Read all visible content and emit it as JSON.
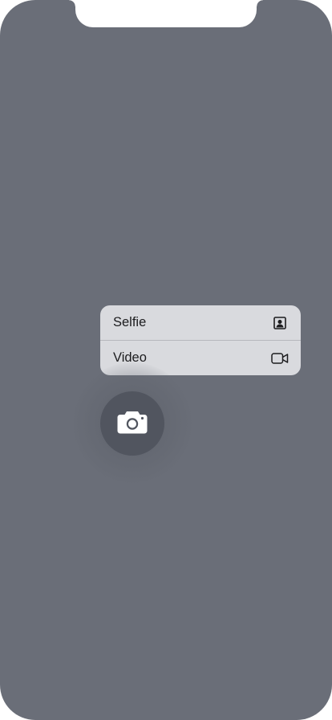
{
  "context_menu": {
    "items": [
      {
        "label": "Selfie",
        "icon": "portrait-icon"
      },
      {
        "label": "Video",
        "icon": "video-camera-icon"
      }
    ]
  },
  "camera_button": {
    "icon": "camera-icon"
  },
  "colors": {
    "background": "#6a6e78",
    "menu_background": "#d9dade",
    "button_background": "#51555f",
    "text": "#1c1c1e"
  }
}
